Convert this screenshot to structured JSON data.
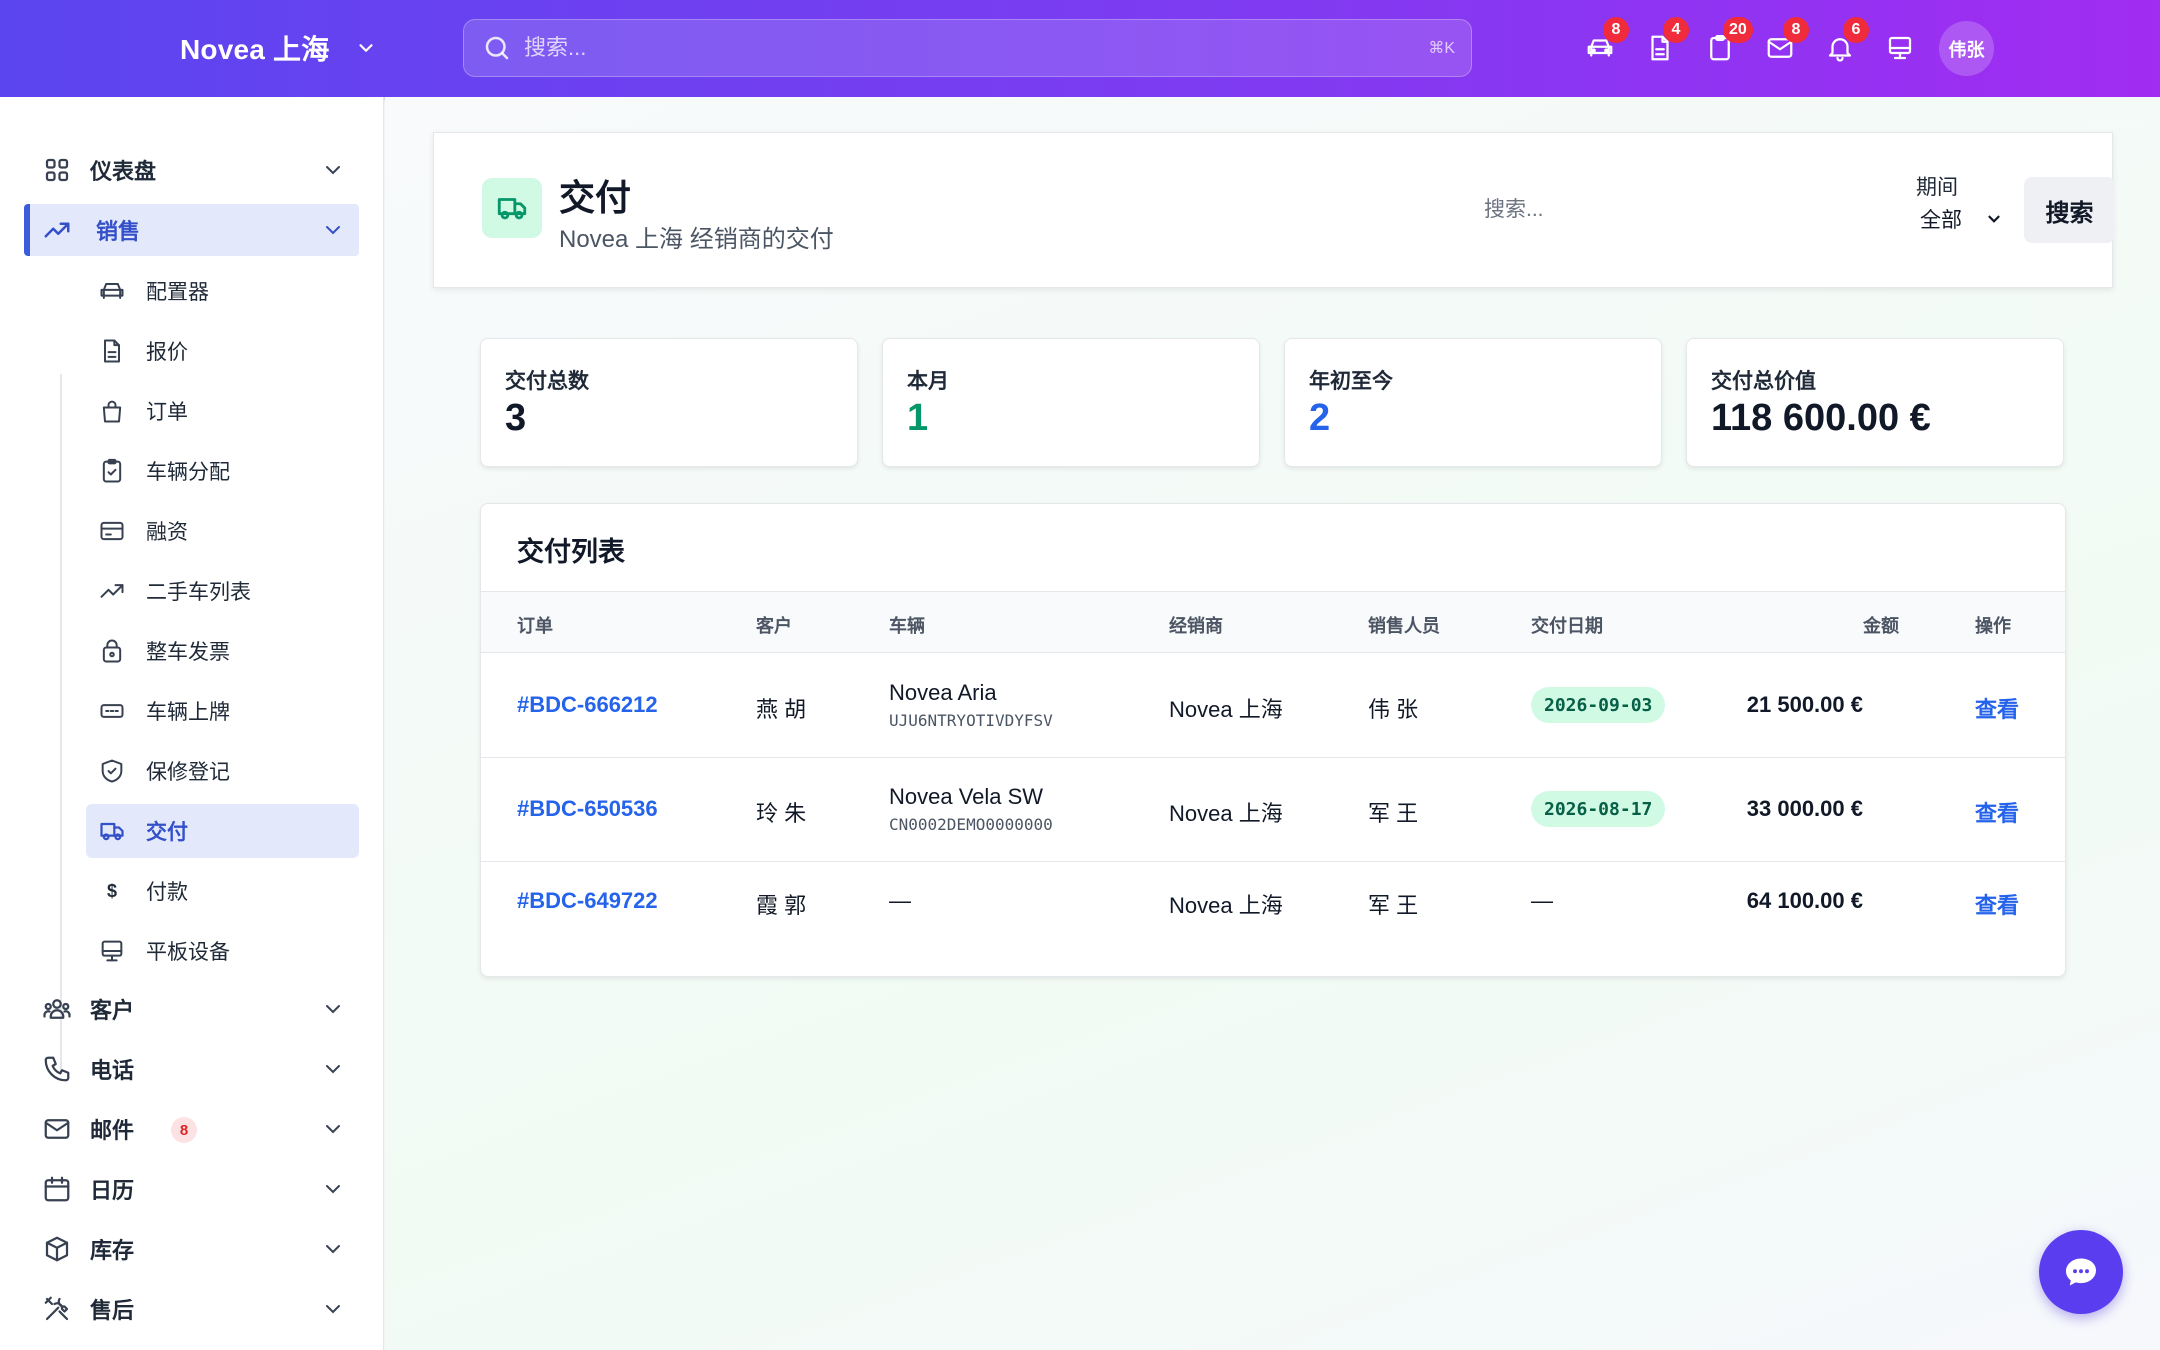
{
  "topbar": {
    "brand": "Novea 上海",
    "search_placeholder": "搜索...",
    "search_shortcut": "⌘K",
    "icons": [
      {
        "name": "car-icon",
        "badge": "8"
      },
      {
        "name": "document-icon",
        "badge": "4"
      },
      {
        "name": "clipboard-icon",
        "badge": "20"
      },
      {
        "name": "mail-icon",
        "badge": "8"
      },
      {
        "name": "bell-icon",
        "badge": "6"
      },
      {
        "name": "monitor-icon",
        "badge": ""
      }
    ],
    "avatar": "伟张"
  },
  "sidebar": {
    "top": [
      {
        "label": "仪表盘"
      },
      {
        "label": "销售"
      },
      {
        "label": "客户"
      },
      {
        "label": "电话"
      },
      {
        "label": "邮件",
        "badge": "8"
      },
      {
        "label": "日历"
      },
      {
        "label": "库存"
      },
      {
        "label": "售后"
      }
    ],
    "sales_items": [
      {
        "label": "配置器"
      },
      {
        "label": "报价"
      },
      {
        "label": "订单"
      },
      {
        "label": "车辆分配"
      },
      {
        "label": "融资"
      },
      {
        "label": "二手车列表"
      },
      {
        "label": "整车发票"
      },
      {
        "label": "车辆上牌"
      },
      {
        "label": "保修登记"
      },
      {
        "label": "交付"
      },
      {
        "label": "付款",
        "glyph": "$"
      },
      {
        "label": "平板设备"
      }
    ],
    "active_item": "交付"
  },
  "header": {
    "title": "交付",
    "subtitle": "Novea 上海 经销商的交付",
    "search_placeholder": "搜索...",
    "period_label": "期间",
    "period_value": "全部",
    "search_button": "搜索"
  },
  "stats": [
    {
      "label": "交付总数",
      "value": "3",
      "color": "#111827"
    },
    {
      "label": "本月",
      "value": "1",
      "color": "#059669"
    },
    {
      "label": "年初至今",
      "value": "2",
      "color": "#2563eb"
    },
    {
      "label": "交付总价值",
      "value": "118 600.00 €",
      "color": "#111827"
    }
  ],
  "table": {
    "title": "交付列表",
    "columns": [
      "订单",
      "客户",
      "车辆",
      "经销商",
      "销售人员",
      "交付日期",
      "金额",
      "操作"
    ],
    "rows": [
      {
        "order": "#BDC-666212",
        "customer": "燕 胡",
        "vehicle": "Novea Aria",
        "vin": "UJU6NTRYOTIVDYFSV",
        "dealer": "Novea 上海",
        "sales": "伟 张",
        "date": "2026-09-03",
        "amount": "21 500.00 €",
        "action": "查看"
      },
      {
        "order": "#BDC-650536",
        "customer": "玲 朱",
        "vehicle": "Novea Vela SW",
        "vin": "CN0002DEMO0000000",
        "dealer": "Novea 上海",
        "sales": "军 王",
        "date": "2026-08-17",
        "amount": "33 000.00 €",
        "action": "查看"
      },
      {
        "order": "#BDC-649722",
        "customer": "霞 郭",
        "vehicle": "—",
        "vin": "",
        "dealer": "Novea 上海",
        "sales": "军 王",
        "date": "—",
        "amount": "64 100.00 €",
        "action": "查看"
      }
    ]
  },
  "colors": {
    "accent": "#3b5bdb",
    "brand_gradient_start": "#5b45ef",
    "brand_gradient_end": "#a12cf2",
    "success": "#059669"
  }
}
